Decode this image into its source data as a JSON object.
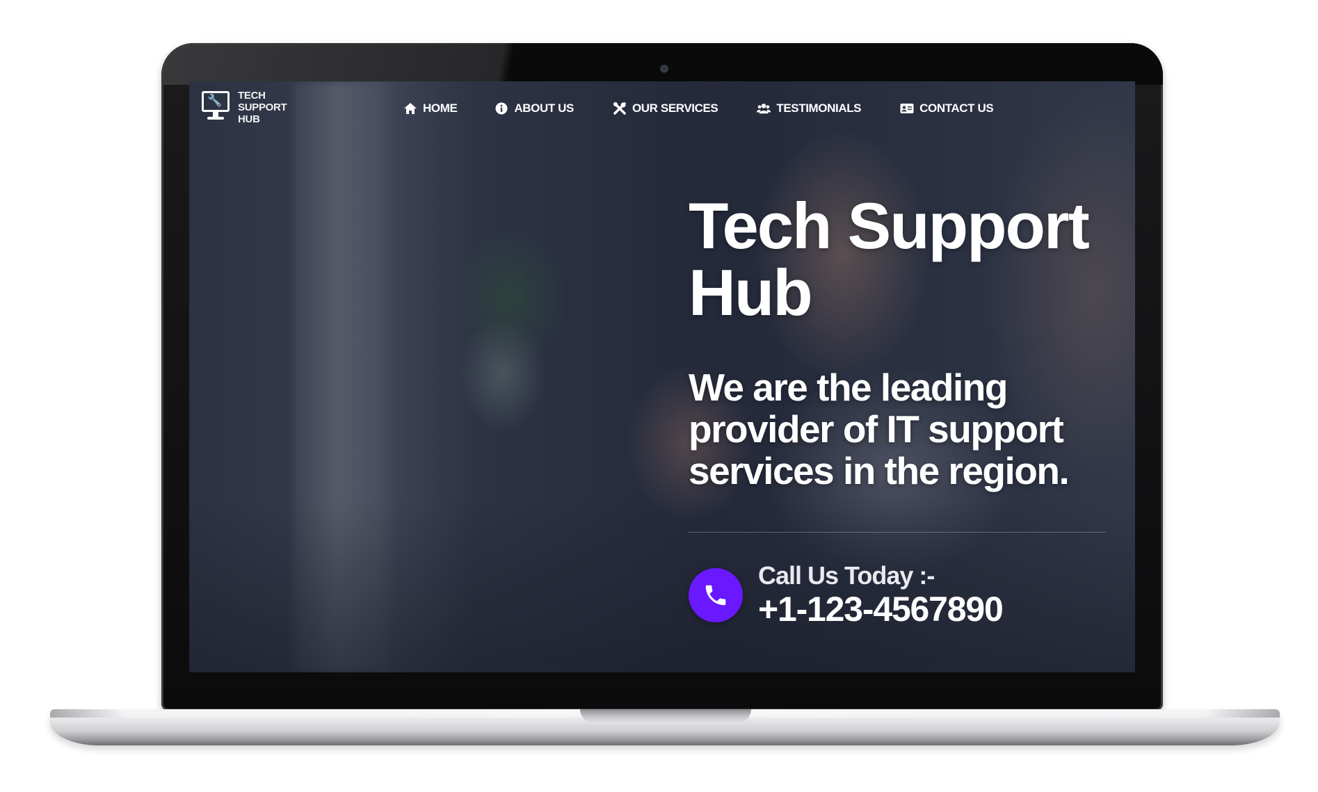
{
  "logo": {
    "lines": [
      "TECH",
      "SUPPORT",
      "HUB"
    ],
    "icon": "monitor-wrench-icon"
  },
  "nav": {
    "items": [
      {
        "label": "HOME",
        "icon": "home-icon"
      },
      {
        "label": "ABOUT US",
        "icon": "info-icon"
      },
      {
        "label": "OUR SERVICES",
        "icon": "tools-icon"
      },
      {
        "label": "TESTIMONIALS",
        "icon": "users-icon"
      },
      {
        "label": "CONTACT US",
        "icon": "id-card-icon"
      }
    ]
  },
  "hero": {
    "title": "Tech Support Hub",
    "subtitle": "We are the leading provider of IT support services in the region."
  },
  "call": {
    "label": "Call Us Today :-",
    "number": "+1-123-4567890",
    "icon": "phone-icon",
    "badge_color": "#6a18ff"
  }
}
